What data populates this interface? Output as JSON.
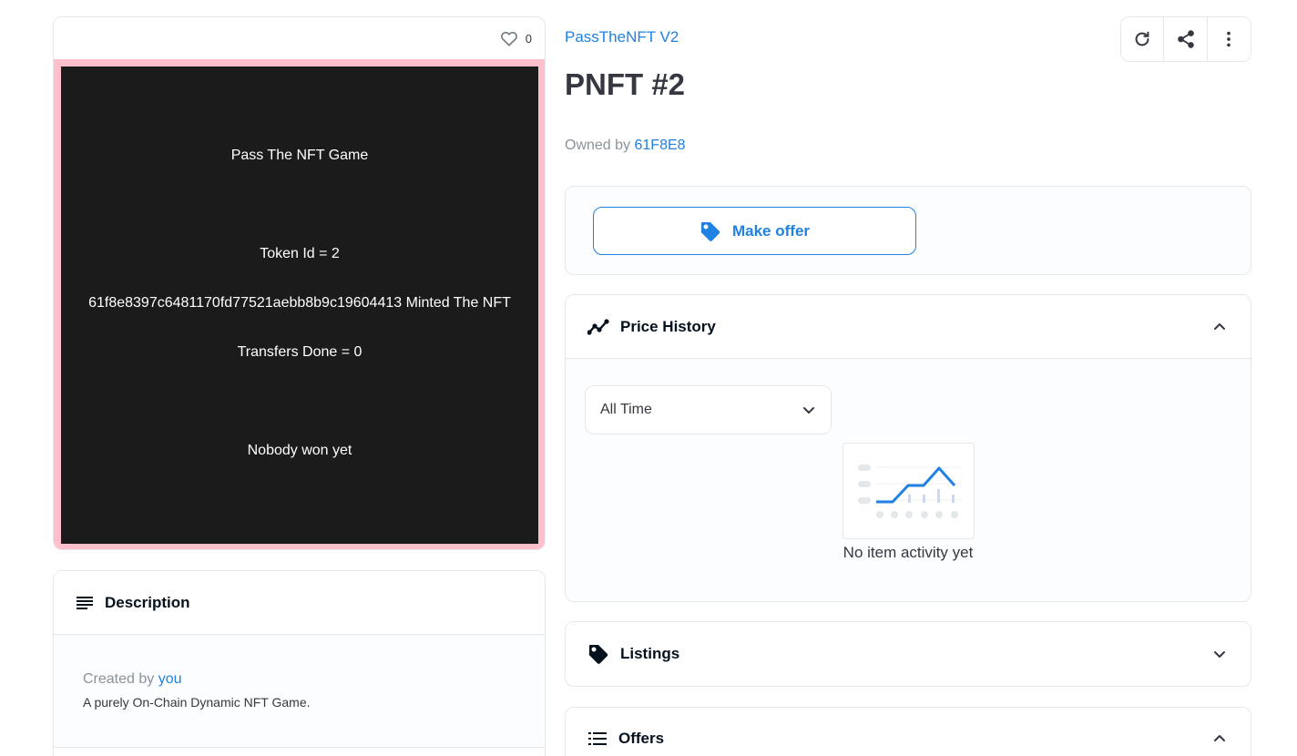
{
  "media": {
    "favorite_count": "0",
    "nft_art": {
      "line1": "Pass The NFT Game",
      "line2": "Token Id = 2",
      "line3": "61f8e8397c6481170fd77521aebb8b9c19604413 Minted The NFT",
      "line4": "Transfers Done = 0",
      "line5": "Nobody won yet",
      "frame_color": "#ffc0cb",
      "background_color": "#1c1b1c"
    }
  },
  "description": {
    "title": "Description",
    "created_by_prefix": "Created by",
    "created_by_link": "you",
    "text": "A purely On-Chain Dynamic NFT Game."
  },
  "header": {
    "collection": "PassTheNFT V2",
    "title": "PNFT #2",
    "owned_by_prefix": "Owned by",
    "owner": "61F8E8",
    "toolbar_icons": [
      "refresh-icon",
      "share-icon",
      "more-vertical-icon"
    ]
  },
  "offer": {
    "button_label": "Make offer"
  },
  "price_history": {
    "title": "Price History",
    "range_selected": "All Time",
    "empty_text": "No item activity yet"
  },
  "listings": {
    "title": "Listings"
  },
  "offers": {
    "title": "Offers"
  },
  "colors": {
    "accent": "#2081e2",
    "border": "#e5e8eb",
    "text": "#04111d"
  }
}
